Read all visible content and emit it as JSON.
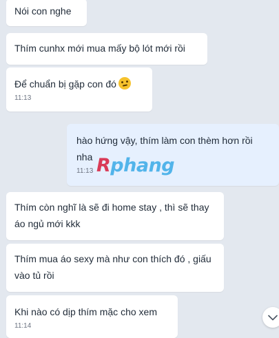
{
  "messages": [
    {
      "text": "Nói con nghe"
    },
    {
      "text": "Thím cunhx mới mua mấy bộ lót mới rồi"
    },
    {
      "text": "Để chuẩn bị gặp con đó",
      "emoji": "thinking-face-icon",
      "time": "11:13"
    },
    {
      "text": "hào hứng vậy, thím làm con thèm hơn rồi nha",
      "time": "11:13"
    },
    {
      "text": "Thím còn nghĩ là sẽ đi home stay , thì sẽ thay áo ngủ mới kkk"
    },
    {
      "text": "Thím mua áo sexy mà như con thích đó , giấu vào tủ rồi"
    },
    {
      "text": "Khi nào có dịp thím mặc cho xem",
      "time": "11:14"
    }
  ],
  "watermark": {
    "first": "R",
    "rest": "phang"
  },
  "scroll_button": {
    "icon": "chevron-down-icon"
  },
  "colors": {
    "background": "#e3e8ef",
    "incoming_bubble": "#ffffff",
    "outgoing_bubble": "#e6f0fe",
    "watermark_r": "#d93a57",
    "watermark_rest": "#52b4ea"
  }
}
